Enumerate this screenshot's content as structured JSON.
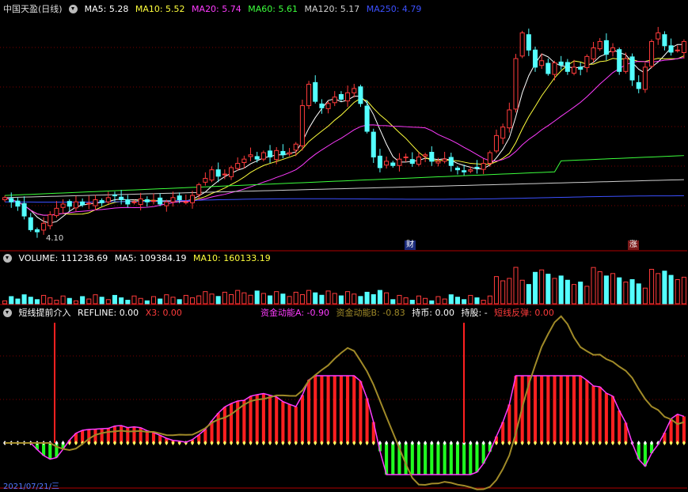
{
  "price_header": {
    "title": "中国天盈(日线)",
    "ma5_label": "MA5:",
    "ma5": "5.28",
    "ma10_label": "MA10:",
    "ma10": "5.52",
    "ma20_label": "MA20:",
    "ma20": "5.74",
    "ma60_label": "MA60:",
    "ma60": "5.61",
    "ma120_label": "MA120:",
    "ma120": "5.17",
    "ma250_label": "MA250:",
    "ma250": "4.79"
  },
  "volume_header": {
    "label": "VOLUME:",
    "value": "111238.69",
    "ma5_label": "MA5:",
    "ma5": "109384.19",
    "ma10_label": "MA10:",
    "ma10": "160133.19"
  },
  "indicator_header": {
    "name": "短线提前介入",
    "refline_label": "REFLINE:",
    "refline": "0.00",
    "x3_label": "X3:",
    "x3": "0.00",
    "fa_label": "资金动能A:",
    "fa": "-0.90",
    "fb_label": "资金动能B:",
    "fb": "-0.83",
    "hold_label": "持币:",
    "hold": "0.00",
    "stock_label": "持股:",
    "stock": "-",
    "rebound_label": "短线反弹:",
    "rebound": "0.00"
  },
  "annotations": {
    "low_price": "4.10",
    "cai": "财",
    "zhang": "涨"
  },
  "date_label": "2021/07/21/三",
  "colors": {
    "up": "#ff3b3b",
    "down": "#54ffff",
    "ma5": "#ffffff",
    "ma10": "#ffff3c",
    "ma20": "#ff3cff",
    "ma60": "#3cff3c",
    "ma120": "#d0d0d0",
    "ma250": "#3c50ff",
    "grid": "#7a0000",
    "axis": "#b00000"
  },
  "chart_data": {
    "type": "candlestick",
    "closes": [
      5.05,
      4.95,
      4.85,
      4.62,
      4.3,
      4.25,
      4.45,
      4.65,
      4.8,
      4.9,
      4.85,
      4.95,
      4.88,
      4.92,
      5.0,
      4.93,
      5.05,
      5.1,
      5.0,
      4.9,
      4.95,
      5.02,
      4.95,
      4.98,
      4.9,
      4.95,
      5.05,
      5.0,
      4.95,
      5.1,
      5.35,
      5.5,
      5.7,
      5.55,
      5.6,
      5.75,
      5.85,
      5.95,
      6.05,
      5.95,
      6.1,
      6.0,
      6.15,
      6.05,
      6.1,
      6.3,
      7.2,
      7.7,
      7.3,
      7.15,
      7.25,
      7.4,
      7.35,
      7.5,
      7.6,
      7.25,
      6.6,
      6.0,
      5.75,
      5.9,
      5.8,
      5.95,
      6.0,
      5.85,
      6.0,
      6.05,
      5.9,
      5.9,
      5.95,
      5.8,
      5.7,
      5.65,
      5.7,
      5.75,
      5.85,
      6.1,
      6.5,
      6.7,
      7.1,
      8.3,
      8.9,
      8.5,
      8.1,
      8.25,
      7.95,
      8.2,
      8.15,
      8.0,
      8.1,
      8.05,
      8.35,
      8.55,
      8.7,
      8.4,
      8.55,
      8.0,
      8.3,
      7.8,
      7.6,
      8.1,
      8.7,
      8.9,
      8.6,
      8.45,
      8.5,
      8.7
    ],
    "ma250_visible": "4.79",
    "low_marker": 4.1,
    "volume_overlay": true
  }
}
